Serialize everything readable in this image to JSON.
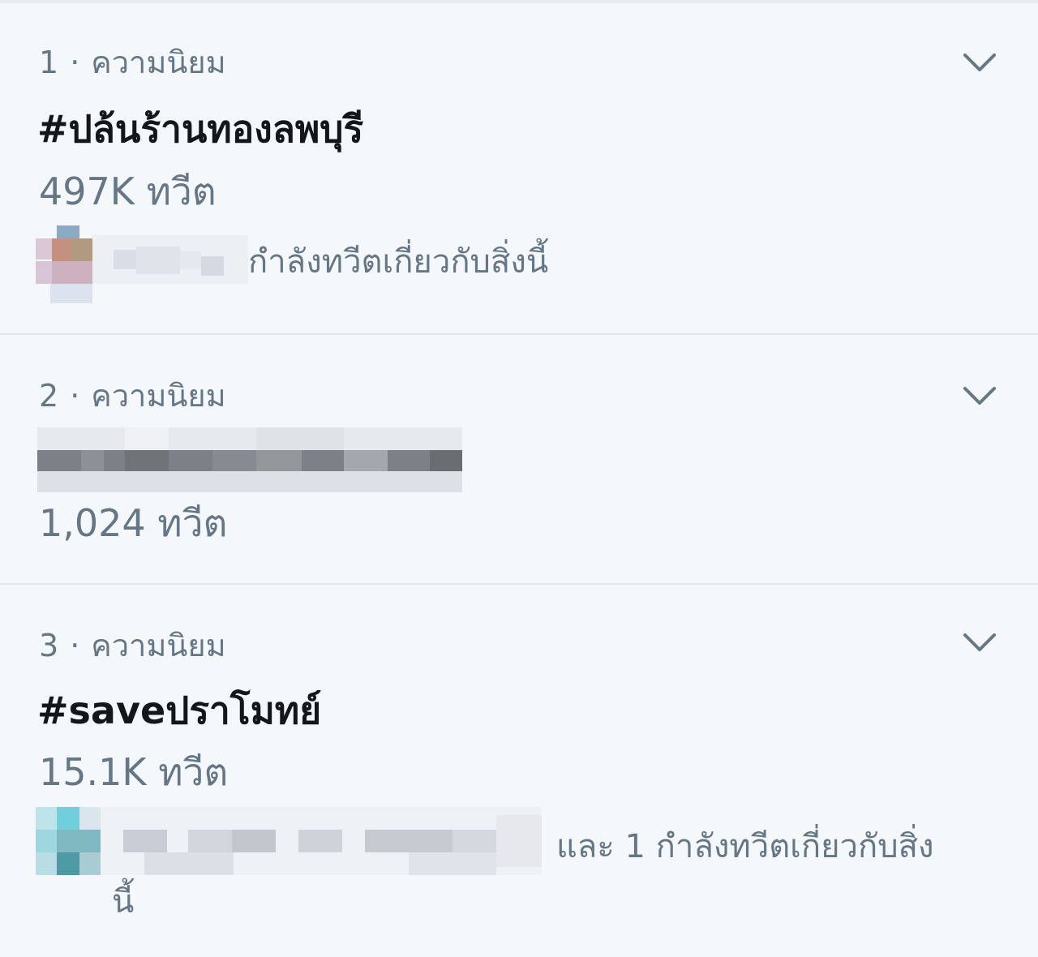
{
  "trends": [
    {
      "meta_rank": "1",
      "meta_label": "ความนิยม",
      "meta_dot": "·",
      "hashtag": "#ปล้นร้านทองลพบุรี",
      "count": "497K ทวีต",
      "context": "กำลังทวีตเกี่ยวกับสิ่งนี้"
    },
    {
      "meta_rank": "2",
      "meta_label": "ความนิยม",
      "meta_dot": "·",
      "hashtag": "",
      "count": "1,024 ทวีต",
      "context": ""
    },
    {
      "meta_rank": "3",
      "meta_label": "ความนิยม",
      "meta_dot": "·",
      "hashtag": "#saveปราโมทย์",
      "count": "15.1K ทวีต",
      "context": "และ 1 กำลังทวีตเกี่ยวกับสิ่ง",
      "context_wrap": "นี้"
    }
  ],
  "icons": {
    "more": "chevron-down-icon"
  },
  "colors": {
    "background": "#f5f8fa",
    "secondary_text": "#657786",
    "primary_text": "#14171a",
    "divider": "#e1e8ed"
  }
}
